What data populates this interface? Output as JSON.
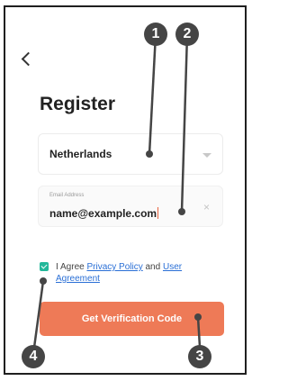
{
  "screen": {
    "title": "Register",
    "back_icon": "chevron-left-icon"
  },
  "form": {
    "country": {
      "value": "Netherlands"
    },
    "email": {
      "label": "Email Address",
      "value": "name@example.com",
      "clear_icon": "×"
    }
  },
  "agreement": {
    "checked": true,
    "prefix": "I Agree ",
    "privacy_link": "Privacy Policy",
    "connector": " and ",
    "user_link": "User Agreement"
  },
  "actions": {
    "submit_label": "Get Verification Code"
  },
  "callouts": [
    "1",
    "2",
    "3",
    "4"
  ],
  "colors": {
    "accent": "#ee7a57",
    "checkbox": "#22b89a",
    "link": "#2a6fd6",
    "callout": "#454545"
  }
}
